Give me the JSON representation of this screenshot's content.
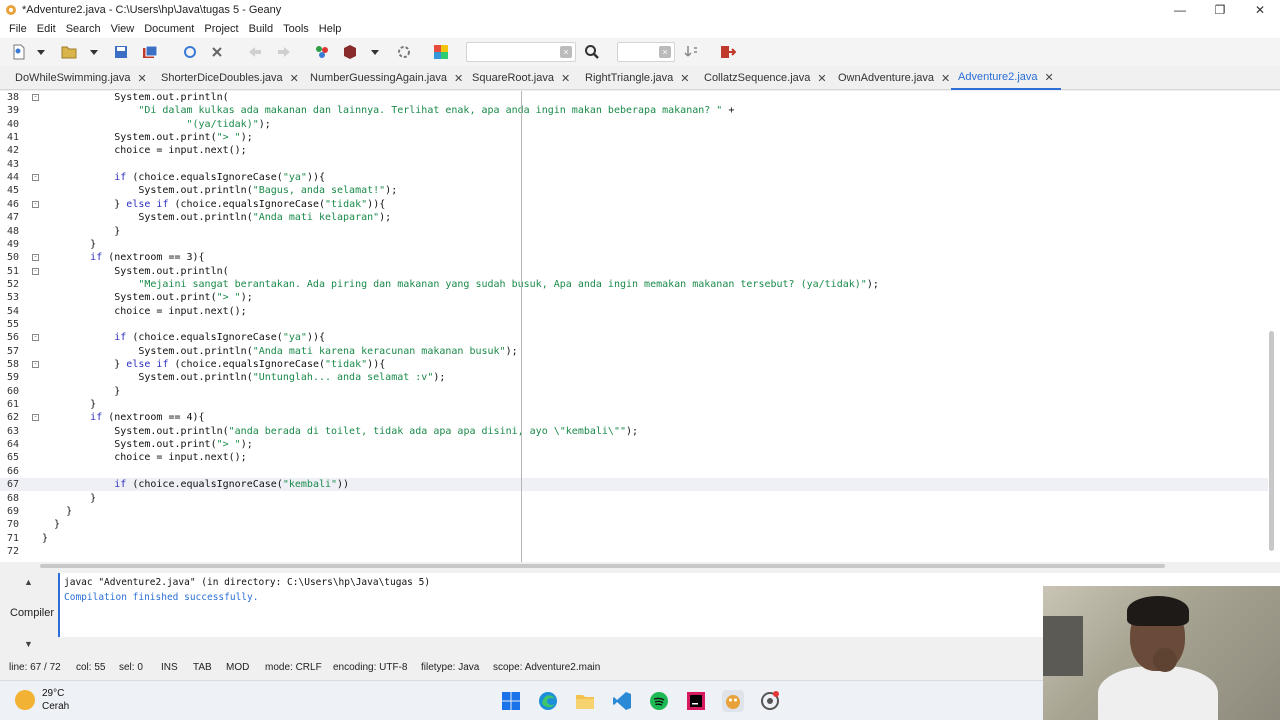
{
  "window": {
    "title": "*Adventure2.java - C:\\Users\\hp\\Java\\tugas 5 - Geany",
    "minimize": "—",
    "restore": "❐",
    "close": "✕"
  },
  "menu": [
    "File",
    "Edit",
    "Search",
    "View",
    "Document",
    "Project",
    "Build",
    "Tools",
    "Help"
  ],
  "toolbar": {
    "search_value": "",
    "goto_value": ""
  },
  "tabs": [
    {
      "label": "DoWhileSwimming.java",
      "active": false
    },
    {
      "label": "ShorterDiceDoubles.java",
      "active": false
    },
    {
      "label": "NumberGuessingAgain.java",
      "active": false
    },
    {
      "label": "SquareRoot.java",
      "active": false
    },
    {
      "label": "RightTriangle.java",
      "active": false
    },
    {
      "label": "CollatzSequence.java",
      "active": false
    },
    {
      "label": "OwnAdventure.java",
      "active": false
    },
    {
      "label": "Adventure2.java",
      "active": true
    }
  ],
  "editor": {
    "current_line": 67,
    "lines": [
      {
        "n": "38",
        "fold": "-",
        "code": "            System.out.println("
      },
      {
        "n": "39",
        "fold": "",
        "code": "                \"Di dalam kulkas ada makanan dan lainnya. Terlihat enak, apa anda ingin makan beberapa makanan? \" +"
      },
      {
        "n": "40",
        "fold": "",
        "code": "                        \"(ya/tidak)\");"
      },
      {
        "n": "41",
        "fold": "",
        "code": "            System.out.print(\"> \");"
      },
      {
        "n": "42",
        "fold": "",
        "code": "            choice = input.next();"
      },
      {
        "n": "43",
        "fold": "",
        "code": ""
      },
      {
        "n": "44",
        "fold": "-",
        "code": "            if (choice.equalsIgnoreCase(\"ya\")){"
      },
      {
        "n": "45",
        "fold": "",
        "code": "                System.out.println(\"Bagus, anda selamat!\");"
      },
      {
        "n": "46",
        "fold": "-",
        "code": "            } else if (choice.equalsIgnoreCase(\"tidak\")){"
      },
      {
        "n": "47",
        "fold": "",
        "code": "                System.out.println(\"Anda mati kelaparan\");"
      },
      {
        "n": "48",
        "fold": "",
        "code": "            }"
      },
      {
        "n": "49",
        "fold": "",
        "code": "        }"
      },
      {
        "n": "50",
        "fold": "-",
        "code": "        if (nextroom == 3){"
      },
      {
        "n": "51",
        "fold": "-",
        "code": "            System.out.println("
      },
      {
        "n": "52",
        "fold": "",
        "code": "                \"Mejaini sangat berantakan. Ada piring dan makanan yang sudah busuk, Apa anda ingin memakan makanan tersebut? (ya/tidak)\");"
      },
      {
        "n": "53",
        "fold": "",
        "code": "            System.out.print(\"> \");"
      },
      {
        "n": "54",
        "fold": "",
        "code": "            choice = input.next();"
      },
      {
        "n": "55",
        "fold": "",
        "code": ""
      },
      {
        "n": "56",
        "fold": "-",
        "code": "            if (choice.equalsIgnoreCase(\"ya\")){"
      },
      {
        "n": "57",
        "fold": "",
        "code": "                System.out.println(\"Anda mati karena keracunan makanan busuk\");"
      },
      {
        "n": "58",
        "fold": "-",
        "code": "            } else if (choice.equalsIgnoreCase(\"tidak\")){"
      },
      {
        "n": "59",
        "fold": "",
        "code": "                System.out.println(\"Untunglah... anda selamat :v\");"
      },
      {
        "n": "60",
        "fold": "",
        "code": "            }"
      },
      {
        "n": "61",
        "fold": "",
        "code": "        }"
      },
      {
        "n": "62",
        "fold": "-",
        "code": "        if (nextroom == 4){"
      },
      {
        "n": "63",
        "fold": "",
        "code": "            System.out.println(\"anda berada di toilet, tidak ada apa apa disini, ayo \\\"kembali\\\"\");"
      },
      {
        "n": "64",
        "fold": "",
        "code": "            System.out.print(\"> \");"
      },
      {
        "n": "65",
        "fold": "",
        "code": "            choice = input.next();"
      },
      {
        "n": "66",
        "fold": "",
        "code": ""
      },
      {
        "n": "67",
        "fold": "",
        "code": "            if (choice.equalsIgnoreCase(\"kembali\"))"
      },
      {
        "n": "68",
        "fold": "",
        "code": "        }"
      },
      {
        "n": "69",
        "fold": "",
        "code": "    }"
      },
      {
        "n": "70",
        "fold": "",
        "code": "  }"
      },
      {
        "n": "71",
        "fold": "",
        "code": "}"
      },
      {
        "n": "72",
        "fold": "",
        "code": ""
      }
    ]
  },
  "panel": {
    "tab_label": "Compiler",
    "messages": [
      {
        "text": "javac \"Adventure2.java\" (in directory: C:\\Users\\hp\\Java\\tugas 5)",
        "color": "#111111"
      },
      {
        "text": "Compilation finished successfully.",
        "color": "#2b6fd6"
      }
    ]
  },
  "statusbar": {
    "line": "line: 67 / 72",
    "col": "col: 55",
    "sel": "sel: 0",
    "ins": "INS",
    "tab": "TAB",
    "mod": "MOD",
    "mode": "mode: CRLF",
    "encoding": "encoding: UTF-8",
    "filetype": "filetype: Java",
    "scope": "scope: Adventure2.main"
  },
  "taskbar": {
    "temp": "29°C",
    "condition": "Cerah",
    "icons": [
      "windows-start-icon",
      "edge-icon",
      "file-explorer-icon",
      "vscode-icon",
      "spotify-icon",
      "intellij-icon",
      "geany-icon",
      "chrome-icon"
    ]
  },
  "colors": {
    "accent": "#2b6fd6",
    "keyword": "#2f2fbf",
    "string": "#1a8a4a"
  }
}
